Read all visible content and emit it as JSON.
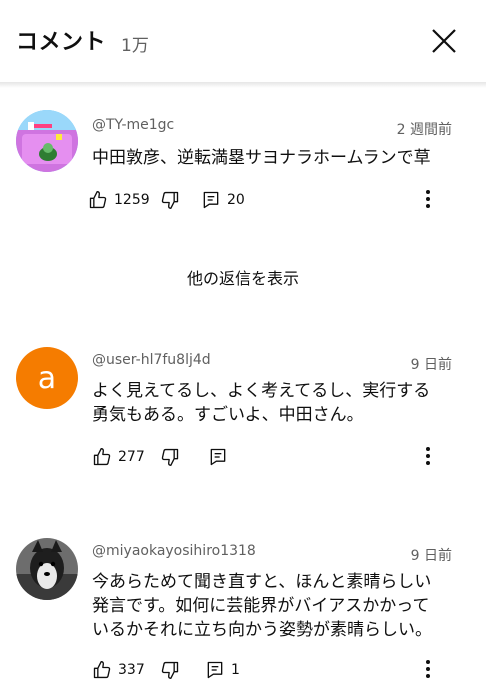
{
  "header": {
    "title": "コメント",
    "count": "1万"
  },
  "comments": [
    {
      "author": "@TY-me1gc",
      "time": "2 週間前",
      "text": "中田敦彦、逆転満塁サヨナラホームランで草",
      "likes": "1259",
      "replies": "20",
      "avatar_icon": "game-screenshot-avatar"
    },
    {
      "author": "@user-hl7fu8lj4d",
      "time": "9 日前",
      "text_lines": [
        "よく見えてるし、よく考えてるし、実行する",
        "勇気もある。すごいよ、中田さん。"
      ],
      "likes": "277",
      "avatar_letter": "a",
      "avatar_color": "#f57c00"
    },
    {
      "author": "@miyaokayosihiro1318",
      "time": "9 日前",
      "text_lines": [
        "今あらためて聞き直すと、ほんと素晴らしい",
        "発言です。如何に芸能界がバイアスかかって",
        "いるかそれに立ち向かう姿勢が素晴らしい。"
      ],
      "likes": "337",
      "replies": "1",
      "avatar_icon": "dog-photo-avatar"
    }
  ],
  "show_replies_label": "他の返信を表示"
}
